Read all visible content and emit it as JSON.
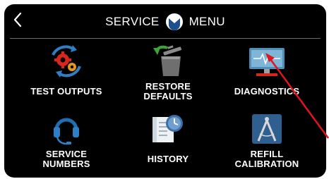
{
  "header": {
    "title_left": "SERVICE",
    "title_right": "MENU"
  },
  "tiles": [
    {
      "label": "TEST OUTPUTS",
      "icon": "gears-refresh-icon"
    },
    {
      "label_line1": "RESTORE",
      "label_line2": "DEFAULTS",
      "icon": "trash-restore-icon"
    },
    {
      "label": "DIAGNOSTICS",
      "icon": "monitor-pulse-icon"
    },
    {
      "label_line1": "SERVICE",
      "label_line2": "NUMBERS",
      "icon": "headset-icon"
    },
    {
      "label": "HISTORY",
      "icon": "document-clock-icon"
    },
    {
      "label_line1": "REFILL",
      "label_line2": "CALIBRATION",
      "icon": "compass-icon"
    }
  ],
  "colors": {
    "background": "#000000",
    "text": "#ffffff",
    "accent_blue": "#2f7fc6",
    "accent_red": "#d9261c",
    "annotation_arrow": "#e0141e"
  }
}
